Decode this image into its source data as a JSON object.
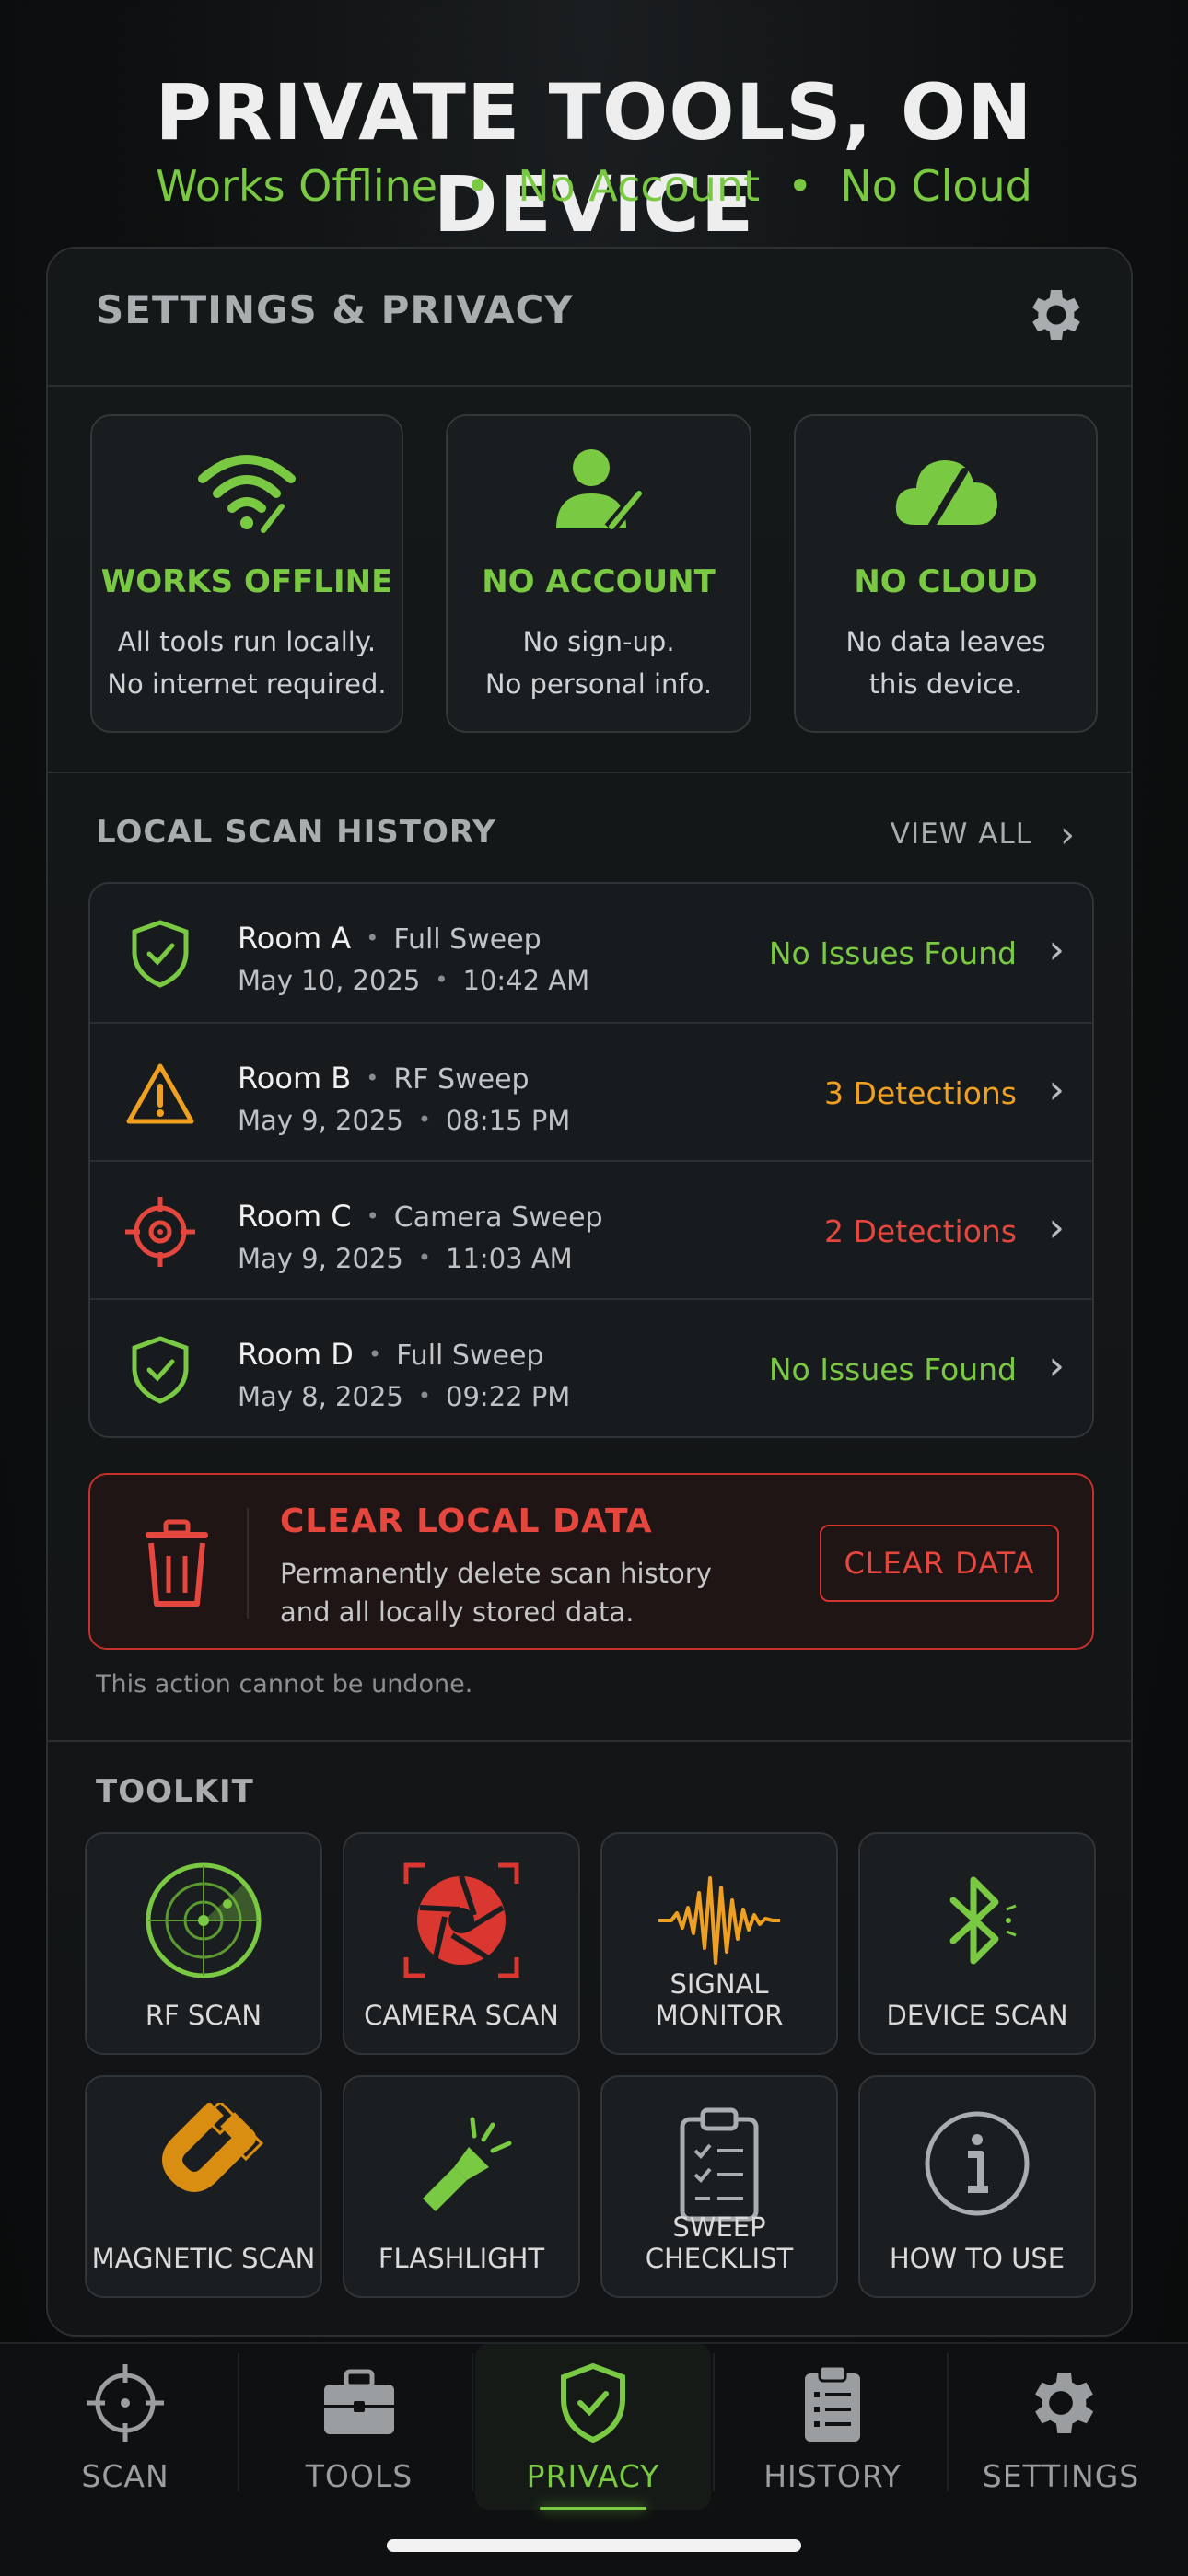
{
  "header": {
    "title": "PRIVATE TOOLS, ON DEVICE",
    "pill_1": "Works Offline",
    "pill_2": "No Account",
    "pill_3": "No Cloud",
    "separator": "•"
  },
  "panel": {
    "title": "SETTINGS & PRIVACY",
    "settings_icon": "gear-icon"
  },
  "features": [
    {
      "icon": "wifi-offline-icon",
      "title": "WORKS OFFLINE",
      "line1": "All tools run locally.",
      "line2": "No internet required."
    },
    {
      "icon": "no-account-icon",
      "title": "NO ACCOUNT",
      "line1": "No sign-up.",
      "line2": "No personal info."
    },
    {
      "icon": "no-cloud-icon",
      "title": "NO CLOUD",
      "line1": "No data leaves",
      "line2": "this device."
    }
  ],
  "history": {
    "label": "LOCAL SCAN HISTORY",
    "view_all": "VIEW ALL",
    "rows": [
      {
        "icon": "shield-check-icon",
        "room": "Room A",
        "type": "Full Sweep",
        "date": "May 10, 2025",
        "time": "10:42 AM",
        "status": "No Issues Found",
        "status_color": "#7ac943"
      },
      {
        "icon": "warning-icon",
        "room": "Room B",
        "type": "RF Sweep",
        "date": "May 9, 2025",
        "time": "08:15 PM",
        "status": "3 Detections",
        "status_color": "#f0a020"
      },
      {
        "icon": "crosshair-icon",
        "room": "Room C",
        "type": "Camera Sweep",
        "date": "May 9, 2025",
        "time": "11:03 AM",
        "status": "2 Detections",
        "status_color": "#e5463d"
      },
      {
        "icon": "shield-check-icon",
        "room": "Room D",
        "type": "Full Sweep",
        "date": "May 8, 2025",
        "time": "09:22 PM",
        "status": "No Issues Found",
        "status_color": "#7ac943"
      }
    ]
  },
  "clear_data": {
    "title": "CLEAR LOCAL DATA",
    "desc_line1": "Permanently delete scan history",
    "desc_line2": "and all locally stored data.",
    "button": "CLEAR DATA",
    "note": "This action cannot be undone."
  },
  "toolkit": {
    "label": "TOOLKIT",
    "tools": [
      {
        "icon": "radar-icon",
        "label": "RF SCAN"
      },
      {
        "icon": "camera-aperture-icon",
        "label": "CAMERA SCAN"
      },
      {
        "icon": "waveform-icon",
        "label": "SIGNAL MONITOR"
      },
      {
        "icon": "bluetooth-icon",
        "label": "DEVICE SCAN"
      },
      {
        "icon": "magnet-icon",
        "label": "MAGNETIC SCAN"
      },
      {
        "icon": "flashlight-icon",
        "label": "FLASHLIGHT"
      },
      {
        "icon": "clipboard-checklist-icon",
        "label": "SWEEP CHECKLIST"
      },
      {
        "icon": "info-icon",
        "label": "HOW TO USE"
      }
    ]
  },
  "nav": [
    {
      "icon": "crosshair-icon",
      "label": "SCAN"
    },
    {
      "icon": "toolbox-icon",
      "label": "TOOLS"
    },
    {
      "icon": "shield-check-icon",
      "label": "PRIVACY",
      "active": true
    },
    {
      "icon": "clipboard-icon",
      "label": "HISTORY"
    },
    {
      "icon": "gear-icon",
      "label": "SETTINGS"
    }
  ],
  "colors": {
    "accent": "#7ac943",
    "warning": "#f0a020",
    "danger": "#e5463d"
  }
}
